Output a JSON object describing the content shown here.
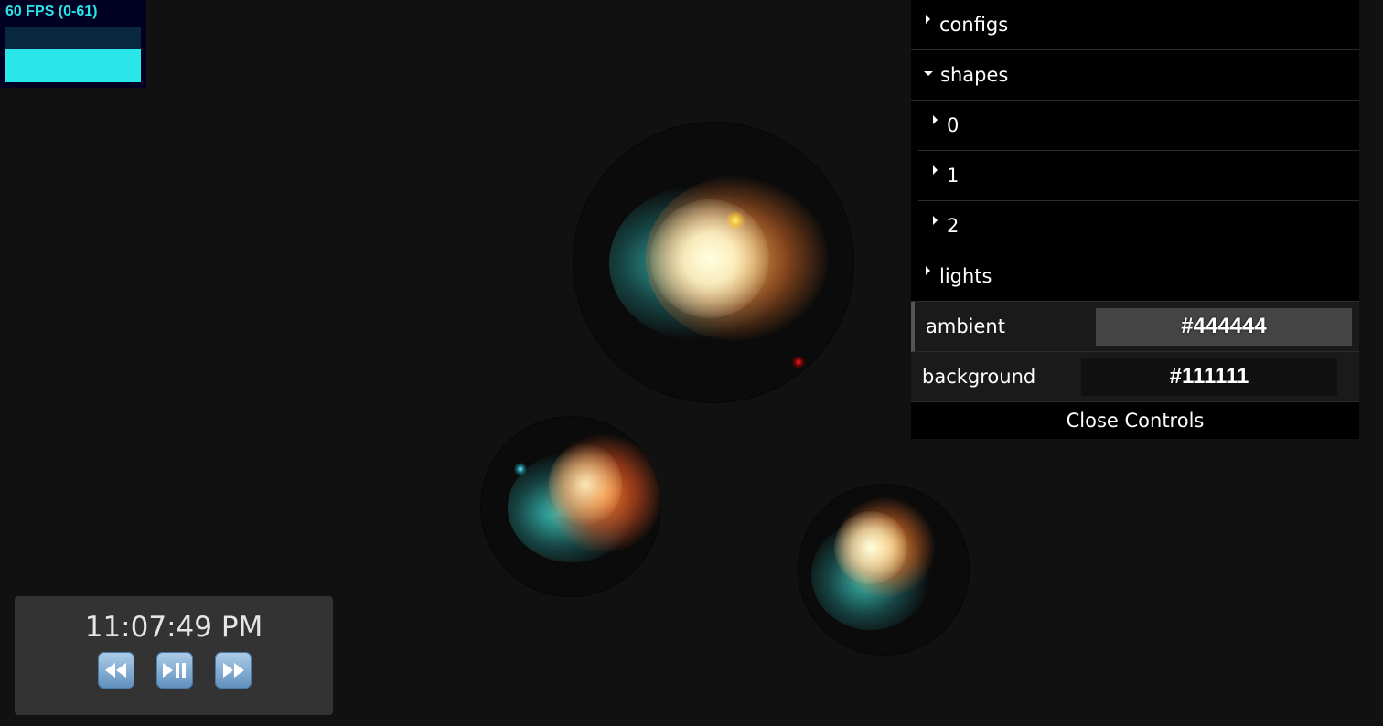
{
  "fps": {
    "label": "60 FPS (0-61)",
    "current": 60,
    "min": 0,
    "max": 61,
    "graph_fill_fraction": 0.6,
    "color": "#2ae6e8"
  },
  "gui": {
    "folders": {
      "configs": "configs",
      "shapes": "shapes",
      "shape_items": [
        "0",
        "1",
        "2"
      ],
      "lights": "lights"
    },
    "controls": {
      "ambient_label": "ambient",
      "ambient_value": "#444444",
      "background_label": "background",
      "background_value": "#111111"
    },
    "close_label": "Close Controls"
  },
  "clock": {
    "time": "11:07:49 PM",
    "buttons": [
      "rewind-icon",
      "play-pause-icon",
      "fast-forward-icon"
    ]
  },
  "colors": {
    "canvas_background": "#111111",
    "ambient": "#444444"
  }
}
